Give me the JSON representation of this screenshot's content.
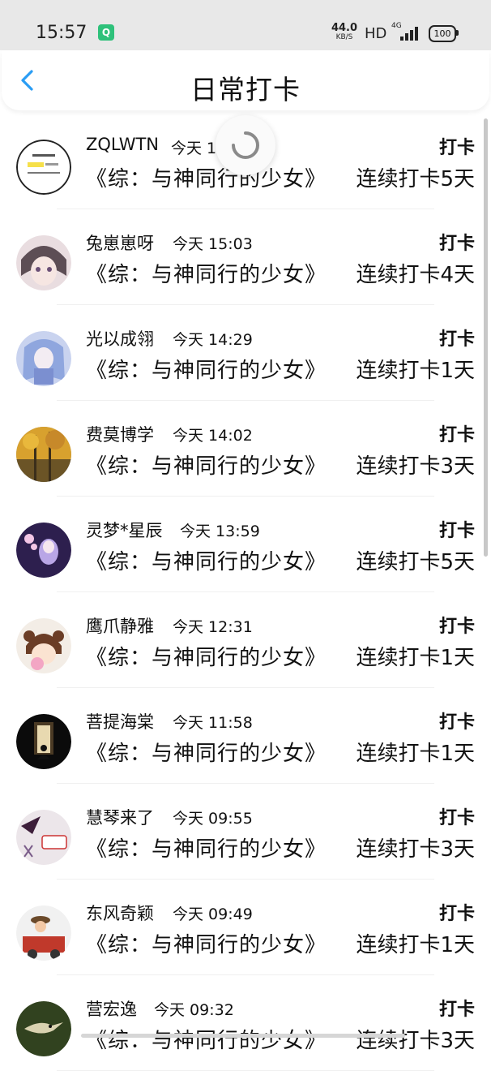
{
  "status_bar": {
    "time": "15:57",
    "app_icon": "Q",
    "net_speed": "44.0",
    "net_unit": "KB/S",
    "hd": "HD",
    "signal_label": "4G",
    "battery": "100"
  },
  "header": {
    "back_icon": "chevron-left-icon",
    "title": "日常打卡"
  },
  "colors": {
    "accent": "#2a9df4",
    "status_bar_bg": "#e8e8e8"
  },
  "entries": [
    {
      "username": "ZQLWTN",
      "time": "今天 1",
      "book": "《综：与神同行的少女》",
      "tag": "打卡",
      "streak": "连续打卡5天"
    },
    {
      "username": "兔崽崽呀",
      "time": "今天 15:03",
      "book": "《综：与神同行的少女》",
      "tag": "打卡",
      "streak": "连续打卡4天"
    },
    {
      "username": "光以成翎",
      "time": "今天 14:29",
      "book": "《综：与神同行的少女》",
      "tag": "打卡",
      "streak": "连续打卡1天"
    },
    {
      "username": "费莫博学",
      "time": "今天 14:02",
      "book": "《综：与神同行的少女》",
      "tag": "打卡",
      "streak": "连续打卡3天"
    },
    {
      "username": "灵梦*星辰",
      "time": "今天 13:59",
      "book": "《综：与神同行的少女》",
      "tag": "打卡",
      "streak": "连续打卡5天"
    },
    {
      "username": "鹰爪静雅",
      "time": "今天 12:31",
      "book": "《综：与神同行的少女》",
      "tag": "打卡",
      "streak": "连续打卡1天"
    },
    {
      "username": "菩提海棠",
      "time": "今天 11:58",
      "book": "《综：与神同行的少女》",
      "tag": "打卡",
      "streak": "连续打卡1天"
    },
    {
      "username": "慧琴来了",
      "time": "今天 09:55",
      "book": "《综：与神同行的少女》",
      "tag": "打卡",
      "streak": "连续打卡3天"
    },
    {
      "username": "东风奇颖",
      "time": "今天 09:49",
      "book": "《综：与神同行的少女》",
      "tag": "打卡",
      "streak": "连续打卡1天"
    },
    {
      "username": "营宏逸",
      "time": "今天 09:32",
      "book": "《综：与神同行的少女》",
      "tag": "打卡",
      "streak": "连续打卡3天"
    }
  ]
}
